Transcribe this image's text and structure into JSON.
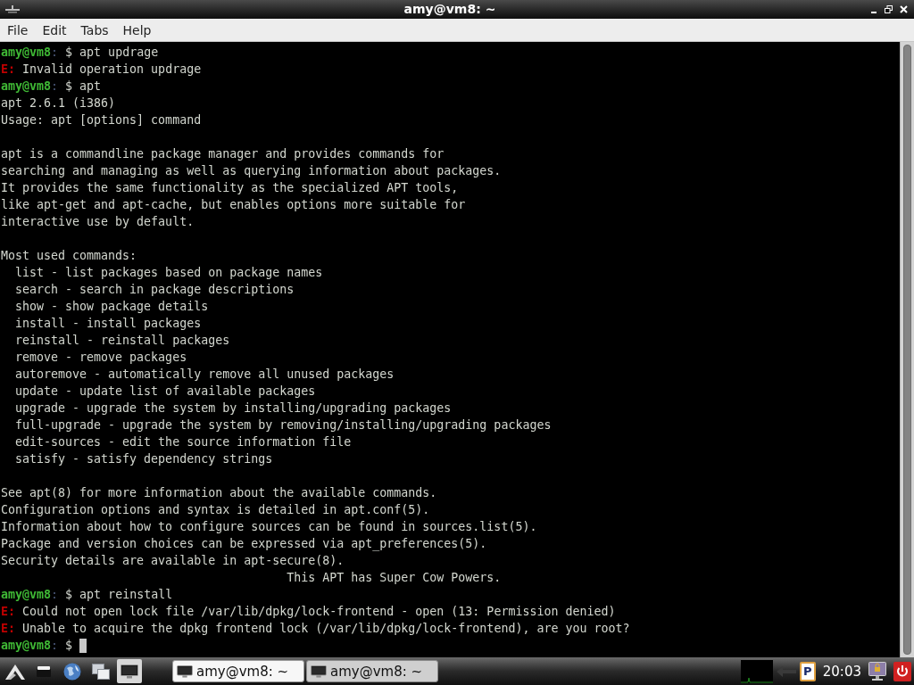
{
  "window": {
    "title": "amy@vm8: ~"
  },
  "menu": [
    {
      "label": "File"
    },
    {
      "label": "Edit"
    },
    {
      "label": "Tabs"
    },
    {
      "label": "Help"
    }
  ],
  "terminal": {
    "lines": [
      {
        "kind": "prompt",
        "user": "amy@vm8",
        "separator": ":",
        "symbol": "$",
        "command": "apt updrage",
        "cursor": false
      },
      {
        "kind": "error",
        "tag": "E:",
        "text": "Invalid operation updrage"
      },
      {
        "kind": "prompt",
        "user": "amy@vm8",
        "separator": ":",
        "symbol": "$",
        "command": "apt",
        "cursor": false
      },
      {
        "kind": "output",
        "text": "apt 2.6.1 (i386)"
      },
      {
        "kind": "output",
        "text": "Usage: apt [options] command"
      },
      {
        "kind": "blank"
      },
      {
        "kind": "output",
        "text": "apt is a commandline package manager and provides commands for"
      },
      {
        "kind": "output",
        "text": "searching and managing as well as querying information about packages."
      },
      {
        "kind": "output",
        "text": "It provides the same functionality as the specialized APT tools,"
      },
      {
        "kind": "output",
        "text": "like apt-get and apt-cache, but enables options more suitable for"
      },
      {
        "kind": "output",
        "text": "interactive use by default."
      },
      {
        "kind": "blank"
      },
      {
        "kind": "output",
        "text": "Most used commands:"
      },
      {
        "kind": "output",
        "text": "  list - list packages based on package names"
      },
      {
        "kind": "output",
        "text": "  search - search in package descriptions"
      },
      {
        "kind": "output",
        "text": "  show - show package details"
      },
      {
        "kind": "output",
        "text": "  install - install packages"
      },
      {
        "kind": "output",
        "text": "  reinstall - reinstall packages"
      },
      {
        "kind": "output",
        "text": "  remove - remove packages"
      },
      {
        "kind": "output",
        "text": "  autoremove - automatically remove all unused packages"
      },
      {
        "kind": "output",
        "text": "  update - update list of available packages"
      },
      {
        "kind": "output",
        "text": "  upgrade - upgrade the system by installing/upgrading packages"
      },
      {
        "kind": "output",
        "text": "  full-upgrade - upgrade the system by removing/installing/upgrading packages"
      },
      {
        "kind": "output",
        "text": "  edit-sources - edit the source information file"
      },
      {
        "kind": "output",
        "text": "  satisfy - satisfy dependency strings"
      },
      {
        "kind": "blank"
      },
      {
        "kind": "output",
        "text": "See apt(8) for more information about the available commands."
      },
      {
        "kind": "output",
        "text": "Configuration options and syntax is detailed in apt.conf(5)."
      },
      {
        "kind": "output",
        "text": "Information about how to configure sources can be found in sources.list(5)."
      },
      {
        "kind": "output",
        "text": "Package and version choices can be expressed via apt_preferences(5)."
      },
      {
        "kind": "output",
        "text": "Security details are available in apt-secure(8)."
      },
      {
        "kind": "output",
        "text": "                                        This APT has Super Cow Powers."
      },
      {
        "kind": "prompt",
        "user": "amy@vm8",
        "separator": ":",
        "symbol": "$",
        "command": "apt reinstall",
        "cursor": false
      },
      {
        "kind": "error",
        "tag": "E:",
        "text": "Could not open lock file /var/lib/dpkg/lock-frontend - open (13: Permission denied)"
      },
      {
        "kind": "error",
        "tag": "E:",
        "text": "Unable to acquire the dpkg frontend lock (/var/lib/dpkg/lock-frontend), are you root?"
      },
      {
        "kind": "prompt",
        "user": "amy@vm8",
        "separator": ":",
        "symbol": "$",
        "cursor": true
      }
    ]
  },
  "taskbar": {
    "launchers": [
      {
        "kind": "logo",
        "highlighted": false
      },
      {
        "kind": "files",
        "highlighted": false
      },
      {
        "kind": "browser",
        "highlighted": false
      },
      {
        "kind": "windows",
        "highlighted": false
      },
      {
        "kind": "terminal",
        "highlighted": true
      }
    ],
    "tasks": [
      {
        "label": "amy@vm8: ~",
        "selected": true
      },
      {
        "label": "amy@vm8: ~",
        "selected": false
      }
    ],
    "tray_badge": "P",
    "clock": "20:03"
  }
}
